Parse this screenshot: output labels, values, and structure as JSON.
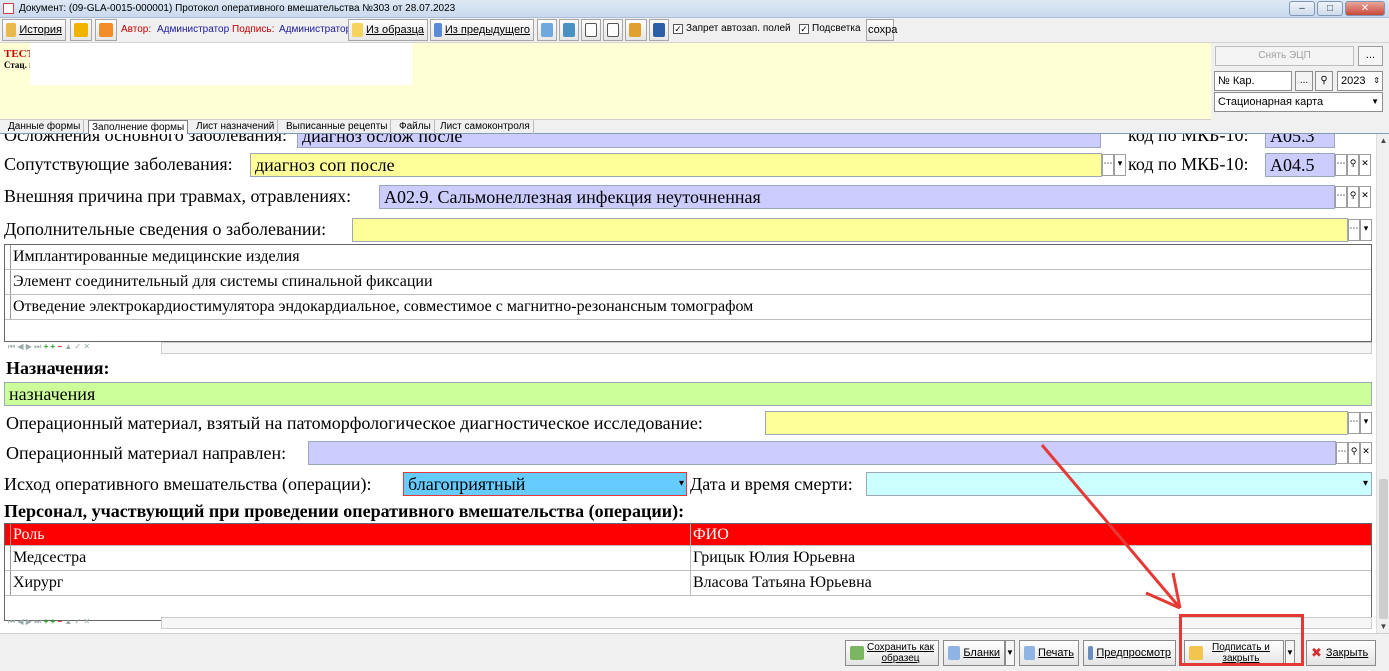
{
  "window": {
    "title": "Документ: (09-GLA-0015-000001) Протокол оперативного вмешательства №303 от 28.07.2023",
    "minimize": "–",
    "maximize": "□",
    "close": "✕"
  },
  "toolbar": {
    "history": "История",
    "author_label": "Автор:",
    "author_value": "Администратор",
    "signature_label": "Подпись:",
    "signature_value": "Администратор",
    "from_template": "Из образца",
    "from_previous": "Из предыдущего",
    "autofill_ban": "Запрет автозап. полей",
    "highlight": "Подсветка",
    "save_short": "сохра"
  },
  "header": {
    "patient_line1": "ТЕСТ",
    "patient_line2": "Стац. в",
    "remove_ecp": "Снять ЭЦП",
    "dots": "...",
    "card_number": "№ Кар.",
    "card_btn_dots": "...",
    "year": "2023",
    "card_type": "Стационарная карта"
  },
  "tabs": [
    {
      "label": "Данные формы"
    },
    {
      "label": "Заполнение формы"
    },
    {
      "label": "Лист назначений"
    },
    {
      "label": "Выписанные рецепты"
    },
    {
      "label": "Файлы"
    },
    {
      "label": "Лист самоконтроля"
    }
  ],
  "form": {
    "complications_label": "Осложнения основного заболевания:",
    "complications_value": "диагноз ослож после",
    "complications_mkb_label": "код по МКБ-10:",
    "complications_mkb_value": "A05.3",
    "concomitant_label": "Сопутствующие заболевания:",
    "concomitant_value": "диагноз соп после",
    "concomitant_mkb_label": "код по МКБ-10:",
    "concomitant_mkb_value": "A04.5",
    "external_cause_label": "Внешняя причина при травмах, отравлениях:",
    "external_cause_value": "A02.9. Сальмонеллезная инфекция неуточненная",
    "additional_info_label": "Дополнительные сведения о заболевании:",
    "additional_info_value": "",
    "implants": [
      "Имплантированные медицинские изделия",
      "Элемент соединительный для системы спинальной фиксации",
      "Отведение электрокардиостимулятора эндокардиальное, совместимое с магнитно-резонансным томографом"
    ],
    "prescriptions_heading": "Назначения:",
    "prescriptions_value": "назначения",
    "material_taken_label": "Операционный материал, взятый на патоморфологическое диагностическое исследование:",
    "material_taken_value": "",
    "material_sent_label": "Операционный материал направлен:",
    "material_sent_value": "",
    "outcome_label": "Исход оперативного вмешательства (операции):",
    "outcome_value": "благоприятный",
    "death_label": "Дата и время смерти:",
    "death_value": "",
    "staff_heading": "Персонал, участвующий при проведении оперативного вмешательства (операции):",
    "staff_columns": [
      "Роль",
      "ФИО"
    ],
    "staff": [
      {
        "role": "Медсестра",
        "name": "Грицык Юлия Юрьевна"
      },
      {
        "role": "Хирург",
        "name": "Власова Татьяна Юрьевна"
      }
    ]
  },
  "bottom": {
    "save_as_template_l1": "Сохранить как",
    "save_as_template_l2": "образец",
    "forms": "Бланки",
    "print": "Печать",
    "preview": "Предпросмотр",
    "sign_close_l1": "Подписать и",
    "sign_close_l2": "закрыть",
    "close": "Закрыть"
  },
  "colors": {
    "required_yellow": "#ffff99",
    "mkb_lavender": "#ccccff",
    "green_field": "#ccff99",
    "outcome_blue": "#66ccff",
    "death_cyan": "#ccffff",
    "table_header_red": "#ff0000",
    "annotation_red": "#e53935"
  }
}
